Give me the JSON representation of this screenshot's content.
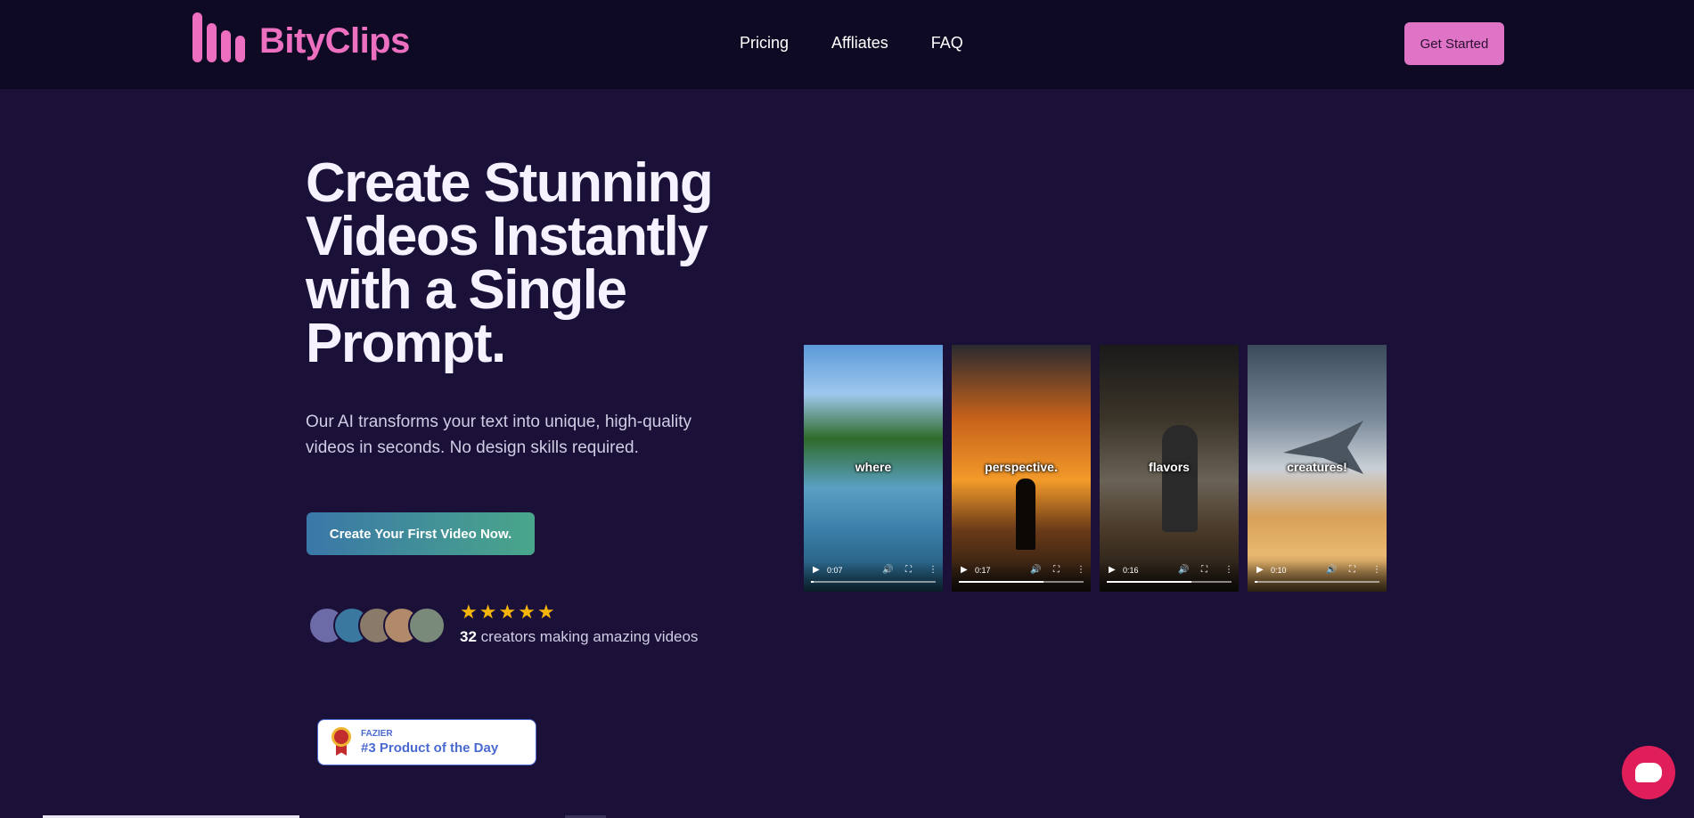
{
  "header": {
    "logo_text": "BityClips",
    "nav": [
      "Pricing",
      "Affliates",
      "FAQ"
    ],
    "cta_label": "Get Started"
  },
  "hero": {
    "title_lines": [
      "Create Stunning",
      "Videos Instantly",
      "with a Single",
      "Prompt."
    ],
    "subtitle_lines": [
      "Our AI transforms your text into unique, high-quality",
      "videos in seconds. No design skills required."
    ],
    "cta_label": "Create Your First Video Now."
  },
  "social_proof": {
    "rating_stars": 5,
    "count": "32",
    "label": "creators making amazing videos",
    "avatar_colors": [
      "#6d6aa8",
      "#3b78a0",
      "#8a7a6a",
      "#b08a6a",
      "#7a8a7a"
    ]
  },
  "badge": {
    "small": "FAZIER",
    "big": "#3 Product of the Day"
  },
  "videos": [
    {
      "caption": "where",
      "time": "0:07",
      "progress": 0.02
    },
    {
      "caption": "perspective.",
      "time": "0:17",
      "progress": 0.68
    },
    {
      "caption": "flavors",
      "time": "0:16",
      "progress": 0.68
    },
    {
      "caption": "creatures!",
      "time": "0:10",
      "progress": 0.02
    }
  ],
  "icons": {
    "play": "play-icon",
    "volume": "volume-icon",
    "fullscreen": "fullscreen-icon",
    "more": "more-vertical-icon",
    "chat": "chat-icon",
    "medal": "medal-icon",
    "star": "star-icon"
  },
  "colors": {
    "brand_pink": "#ec6fc0",
    "header_bg": "#0f0a24",
    "page_bg": "#1a1038",
    "star": "#f5b50a",
    "chat": "#e01e5a"
  }
}
